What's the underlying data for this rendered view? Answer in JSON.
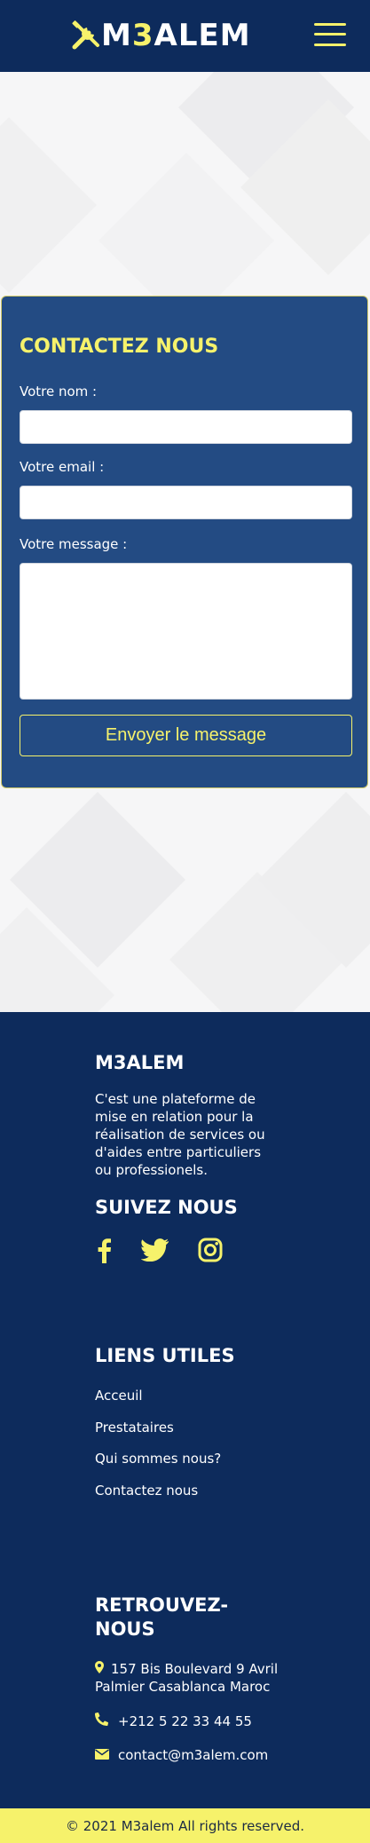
{
  "header": {
    "logo_main": "M3ALEM",
    "logo_prefix": "M",
    "logo_highlight": "3",
    "logo_suffix": "ALEM",
    "menu_icon": "hamburger-menu-icon",
    "brand_color": "#0d2b5c",
    "accent_color": "#f6f26b"
  },
  "contact_form": {
    "title": "CONTACTEZ NOUS",
    "name_label": "Votre nom :",
    "name_value": "",
    "email_label": "Votre email :",
    "email_value": "",
    "message_label": "Votre message :",
    "message_value": "",
    "submit_label": "Envoyer le message",
    "panel_color": "#234b83"
  },
  "footer": {
    "brand_title": "M3ALEM",
    "about_text": "C'est une plateforme de mise en relation pour la réalisation de services ou d'aides entre particuliers ou professionels.",
    "follow_title": "SUIVEZ NOUS",
    "social_icons": [
      "facebook-icon",
      "twitter-icon",
      "instagram-icon"
    ],
    "links_title": "LIENS UTILES",
    "links": [
      "Acceuil",
      "Prestataires",
      "Qui sommes nous?",
      "Contactez nous"
    ],
    "find_title_line1": "RETROUVEZ-",
    "find_title_line2": "NOUS",
    "address_line1": "157 Bis Boulevard 9 Avril",
    "address_line2": "Palmier Casablanca Maroc",
    "phone": "+212 5 22 33 44 55",
    "email": "contact@m3alem.com"
  },
  "copyright": "© 2021 M3alem All rights reserved."
}
